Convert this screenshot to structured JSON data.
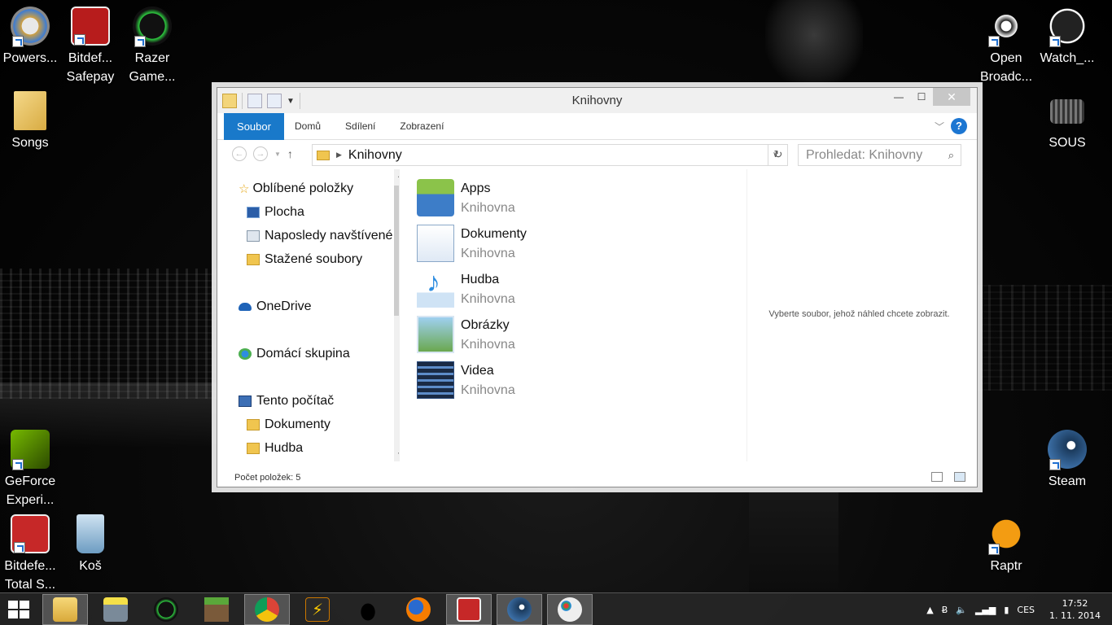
{
  "desktop": {
    "icons": [
      {
        "label": "Powers...",
        "color": "#c0c8cc"
      },
      {
        "label": "Bitdef...",
        "label2": "Safepay",
        "color": "#b71c1c"
      },
      {
        "label": "Razer",
        "label2": "Game...",
        "color": "#1b1b1b"
      },
      {
        "label": "Songs",
        "color": "#e8c46a"
      },
      {
        "label": "GeForce",
        "label2": "Experi...",
        "color": "#76b900"
      },
      {
        "label": "Bitdefe...",
        "label2": "Total S...",
        "color": "#c62828"
      },
      {
        "label": "Koš",
        "color": "#5b8fb9"
      },
      {
        "label": "Open",
        "label2": "Broadc...",
        "color": "#2a2a2a"
      },
      {
        "label": "Watch_...",
        "color": "#222"
      },
      {
        "label": "SOUS",
        "color": "#444"
      },
      {
        "label": "Steam",
        "color": "#1b3a5c"
      },
      {
        "label": "Raptr",
        "color": "#f39c12"
      }
    ]
  },
  "window": {
    "title": "Knihovny",
    "ribbon": {
      "file_tab": "Soubor",
      "tabs": [
        "Domů",
        "Sdílení",
        "Zobrazení"
      ],
      "help": "?"
    },
    "address": {
      "path": "Knihovny",
      "search_placeholder": "Prohledat: Knihovny"
    },
    "nav_pane": [
      {
        "label": "Oblíbené položky",
        "icon": "star-icon"
      },
      {
        "label": "Plocha",
        "icon": "desktop-icon"
      },
      {
        "label": "Naposledy navštívené",
        "icon": "recent-places-icon"
      },
      {
        "label": "Stažené soubory",
        "icon": "downloads-folder-icon"
      },
      {
        "label": "OneDrive",
        "icon": "onedrive-icon"
      },
      {
        "label": "Domácí skupina",
        "icon": "homegroup-icon"
      },
      {
        "label": "Tento počítač",
        "icon": "computer-icon"
      },
      {
        "label": "Dokumenty",
        "icon": "documents-folder-icon"
      },
      {
        "label": "Hudba",
        "icon": "music-folder-icon"
      }
    ],
    "libraries": [
      {
        "name": "Apps",
        "type": "Knihovna",
        "icon": "apps-library-icon"
      },
      {
        "name": "Dokumenty",
        "type": "Knihovna",
        "icon": "documents-library-icon"
      },
      {
        "name": "Hudba",
        "type": "Knihovna",
        "icon": "music-library-icon"
      },
      {
        "name": "Obrázky",
        "type": "Knihovna",
        "icon": "pictures-library-icon"
      },
      {
        "name": "Videa",
        "type": "Knihovna",
        "icon": "videos-library-icon"
      }
    ],
    "preview_message": "Vyberte soubor, jehož náhled chcete zobrazit.",
    "status": "Počet položek: 5"
  },
  "taskbar": {
    "items": [
      "file-explorer",
      "monitor-99",
      "razer-game-booster",
      "minecraft",
      "chrome",
      "power-app",
      "dog-app",
      "firefox",
      "bitdefender",
      "steam",
      "paint"
    ],
    "tray": {
      "language": "CES",
      "time": "17:52",
      "date": "1. 11. 2014"
    }
  },
  "colors": {
    "accent": "#1979ca",
    "taskbar": "#282828"
  }
}
